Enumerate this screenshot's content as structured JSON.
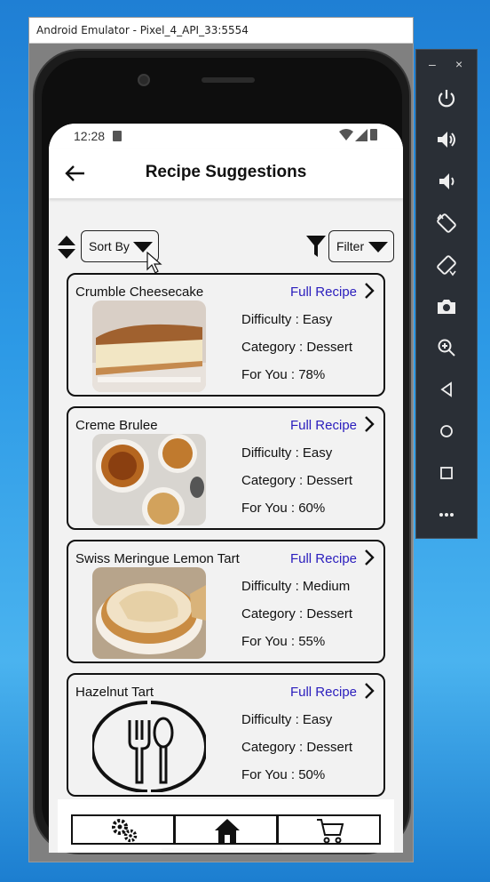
{
  "emulator": {
    "window_title": "Android Emulator - Pixel_4_API_33:5554",
    "toolbar": {
      "minimize_glyph": "–",
      "close_glyph": "×",
      "buttons": [
        "power-icon",
        "volume-up-icon",
        "volume-down-icon",
        "rotate-left-icon",
        "rotate-right-icon",
        "camera-icon",
        "zoom-icon",
        "back-icon",
        "home-icon",
        "overview-icon",
        "more-icon"
      ]
    }
  },
  "status_bar": {
    "time": "12:28"
  },
  "app_bar": {
    "title": "Recipe Suggestions"
  },
  "controls": {
    "sort_label": "Sort By",
    "filter_label": "Filter"
  },
  "recipes": [
    {
      "name": "Crumble Cheesecake",
      "link": "Full Recipe",
      "difficulty": "Difficulty : Easy",
      "category": "Category : Dessert",
      "for_you": "For You : 78%",
      "image": "cheesecake-photo"
    },
    {
      "name": "Creme Brulee",
      "link": "Full Recipe",
      "difficulty": "Difficulty : Easy",
      "category": "Category : Dessert",
      "for_you": "For You : 60%",
      "image": "creme-brulee-photo"
    },
    {
      "name": "Swiss Meringue Lemon Tart",
      "link": "Full Recipe",
      "difficulty": "Difficulty : Medium",
      "category": "Category : Dessert",
      "for_you": "For You : 55%",
      "image": "lemon-tart-photo"
    },
    {
      "name": "Hazelnut Tart",
      "link": "Full Recipe",
      "difficulty": "Difficulty : Easy",
      "category": "Category : Dessert",
      "for_you": "For You : 50%",
      "image": "fork-spoon-plate-icon"
    }
  ],
  "bottom_nav": [
    "settings-icon",
    "home-icon",
    "cart-icon"
  ],
  "colors": {
    "link": "#2a1dbd",
    "screen_bg": "#f2f2f2",
    "desktop": "#2d9ae6",
    "toolbar": "#2a2f36"
  }
}
